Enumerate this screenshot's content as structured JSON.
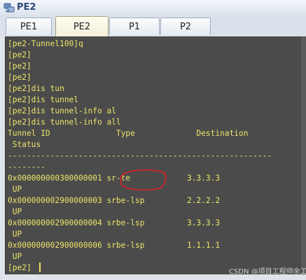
{
  "window": {
    "title": "PE2"
  },
  "tabs": [
    {
      "label": "PE1",
      "active": false
    },
    {
      "label": "PE2",
      "active": true
    },
    {
      "label": "P1",
      "active": false
    },
    {
      "label": "P2",
      "active": false
    }
  ],
  "terminal": {
    "text_color": "#ece46a",
    "background": "#4b4b4b",
    "lines": [
      "[pe2-Tunnel100]q",
      "[pe2]",
      "[pe2]",
      "[pe2]",
      "[pe2]dis tun",
      "[pe2]dis tunnel",
      "[pe2]dis tunnel-info al",
      "[pe2]dis tunnel-info all",
      "Tunnel ID              Type             Destination",
      " Status",
      "--------------------------------------------------------",
      "--------",
      "0x000000000300000001 sr-te            3.3.3.3",
      " UP",
      "0x000000002900000003 srbe-lsp         2.2.2.2",
      " UP",
      "0x000000002900000004 srbe-lsp         3.3.3.3",
      " UP",
      "0x000000002900000006 srbe-lsp         1.1.1.1",
      " UP",
      "[pe2]"
    ]
  },
  "annotation": {
    "color": "#e0202a",
    "target": "sr-te"
  },
  "watermark": "CSDN @项目工程师余工"
}
